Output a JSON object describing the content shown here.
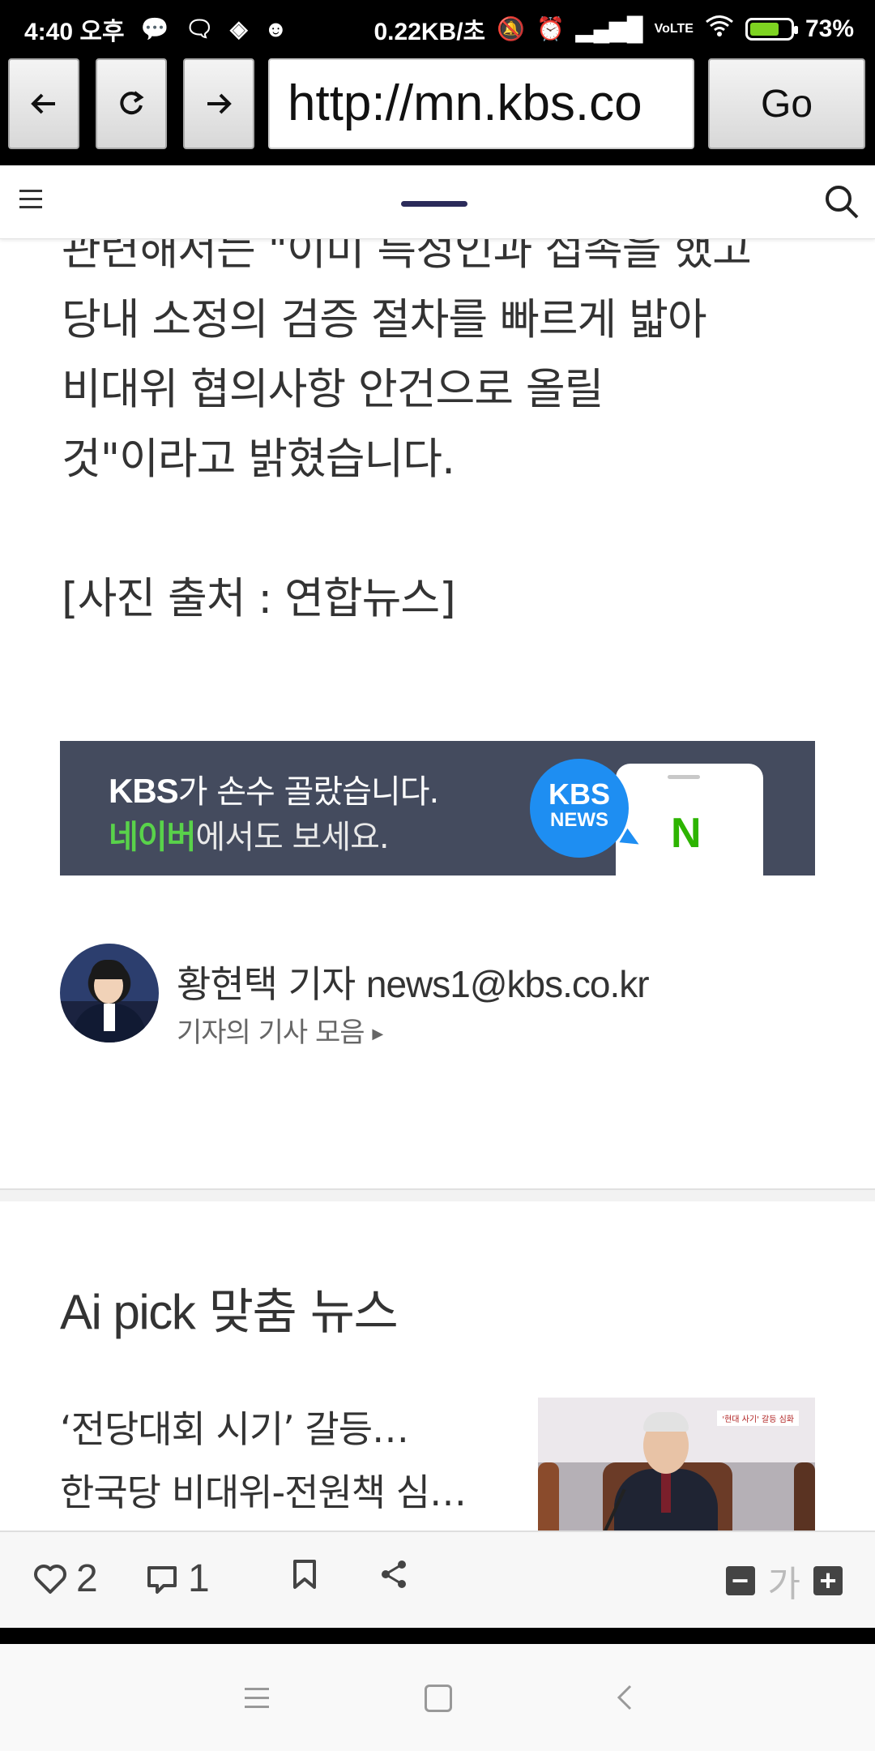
{
  "status_bar": {
    "time": "4:40 오후",
    "net_speed": "0.22KB/초",
    "battery": "73%",
    "battery_level": 0.73,
    "icons": [
      "message-bubble-icon",
      "chat-icon",
      "app-icon",
      "cat-icon",
      "mute-icon",
      "alarm-icon",
      "signal-icon",
      "volte-icon",
      "wifi-icon",
      "battery-charging-icon"
    ]
  },
  "browser": {
    "url": "http://mn.kbs.co",
    "go_label": "Go",
    "back_icon": "arrow-left-icon",
    "reload_icon": "reload-icon",
    "forward_icon": "arrow-right-icon"
  },
  "article": {
    "paragraph_lines": [
      "관련해서는 \"이미 특정인과 접촉을 했고",
      "당내 소정의 검증 절차를 빠르게 밟아",
      "비대위 협의사항 안건으로 올릴",
      "것\"이라고 밝혔습니다."
    ],
    "photo_caption": "[사진 출처 : 연합뉴스]"
  },
  "banner": {
    "line1_brand": "KBS",
    "line1_rest": "가 손수 골랐습니다.",
    "line2_brand": "네이버",
    "line2_rest": "에서도 보세요.",
    "badge_top": "KBS",
    "badge_bottom": "NEWS",
    "naver_letter": "N",
    "naver_color": "#2db400"
  },
  "reporter": {
    "name": "황현택 기자",
    "email": "news1@kbs.co.kr",
    "link": "기자의 기사 모음"
  },
  "ai_pick": {
    "title_en": "Ai pick",
    "title_ko": " 맞춤 뉴스",
    "items": [
      {
        "title_line1": "‘전당대회 시기’ 갈등…",
        "title_line2": "한국당 비대위-전원책 심…",
        "thumb_tag": "'현대 사기' 갈등 심화"
      }
    ]
  },
  "action_bar": {
    "likes": "2",
    "comments": "1",
    "font_label": "가",
    "font_minus": "−",
    "font_plus": "+"
  },
  "colors": {
    "banner_bg": "#444b5e",
    "kbs_blue": "#1e8ef2",
    "header_accent": "#2b2b5a"
  }
}
